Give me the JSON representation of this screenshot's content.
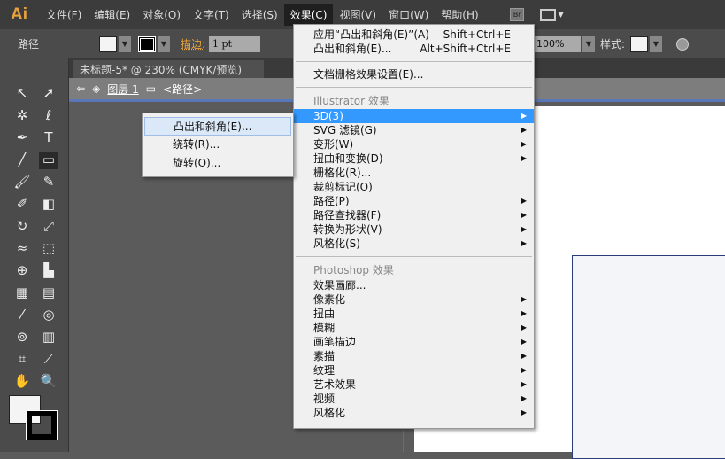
{
  "app": {
    "logo": "Ai"
  },
  "menubar": [
    "文件(F)",
    "编辑(E)",
    "对象(O)",
    "文字(T)",
    "选择(S)",
    "效果(C)",
    "视图(V)",
    "窗口(W)",
    "帮助(H)"
  ],
  "bridge": "Br",
  "control": {
    "label": "路径",
    "stroke_label": "描边:",
    "stroke_value": "1 pt",
    "opacity": "100%",
    "style_label": "样式:"
  },
  "doc_tab": {
    "title": "未标题-5* @ 230% (CMYK/预览)",
    "close": "×"
  },
  "breadcrumb": {
    "layer": "图层 1",
    "item": "<路径>"
  },
  "effect_menu": {
    "apply": {
      "label": "应用“凸出和斜角(E)”(A)",
      "shortcut": "Shift+Ctrl+E"
    },
    "last": {
      "label": "凸出和斜角(E)...",
      "shortcut": "Alt+Shift+Ctrl+E"
    },
    "raster": "文档栅格效果设置(E)...",
    "illustrator_header": "Illustrator 效果",
    "illustrator_items": [
      {
        "label": "3D(3)",
        "sub": true
      },
      {
        "label": "SVG 滤镜(G)",
        "sub": true
      },
      {
        "label": "变形(W)",
        "sub": true
      },
      {
        "label": "扭曲和变换(D)",
        "sub": true
      },
      {
        "label": "栅格化(R)...",
        "sub": false
      },
      {
        "label": "裁剪标记(O)",
        "sub": false
      },
      {
        "label": "路径(P)",
        "sub": true
      },
      {
        "label": "路径查找器(F)",
        "sub": true
      },
      {
        "label": "转换为形状(V)",
        "sub": true
      },
      {
        "label": "风格化(S)",
        "sub": true
      }
    ],
    "photoshop_header": "Photoshop 效果",
    "photoshop_items": [
      {
        "label": "效果画廊...",
        "sub": false
      },
      {
        "label": "像素化",
        "sub": true
      },
      {
        "label": "扭曲",
        "sub": true
      },
      {
        "label": "模糊",
        "sub": true
      },
      {
        "label": "画笔描边",
        "sub": true
      },
      {
        "label": "素描",
        "sub": true
      },
      {
        "label": "纹理",
        "sub": true
      },
      {
        "label": "艺术效果",
        "sub": true
      },
      {
        "label": "视频",
        "sub": true
      },
      {
        "label": "风格化",
        "sub": true
      }
    ]
  },
  "submenu_3d": [
    "凸出和斜角(E)...",
    "绕转(R)...",
    "旋转(O)..."
  ]
}
